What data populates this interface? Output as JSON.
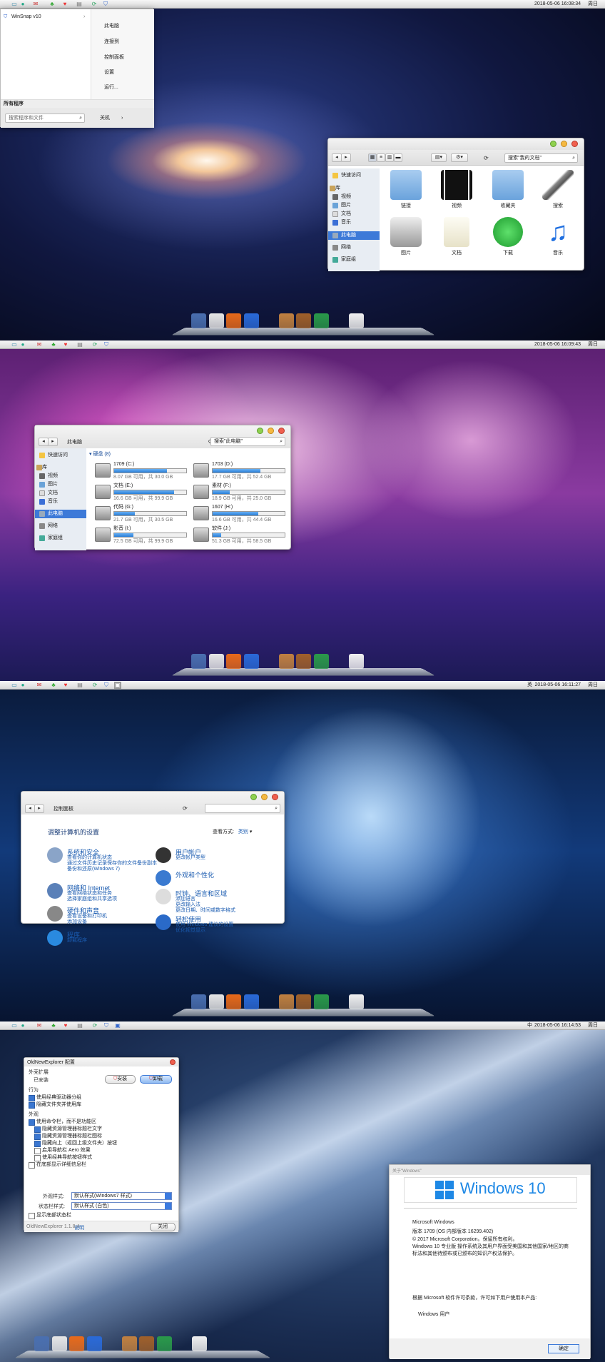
{
  "menubar": {
    "clocks": [
      "2018-05-06  16:08:34",
      "2018-05-06  16:09:43",
      "2018-05-06  16:11:27",
      "2018-05-06  16:14:53"
    ],
    "weekday": "周日",
    "langs": [
      "",
      "",
      "英",
      "中"
    ]
  },
  "start_menu": {
    "pinned": "WinSnap v10",
    "right_items": [
      "此电脑",
      "连接到",
      "控制面板",
      "设置",
      "运行..."
    ],
    "all_programs": "所有程序",
    "search_placeholder": "搜索程序和文件",
    "shutdown": "关机"
  },
  "explorer1": {
    "address": "",
    "search": "搜索\"我的文档\"",
    "sidebar": [
      "快速访问",
      "库",
      "视频",
      "图片",
      "文档",
      "音乐",
      "此电脑",
      "网络",
      "家庭组"
    ],
    "icons": [
      "链接",
      "视频",
      "收藏夹",
      "搜索",
      "图片",
      "文档",
      "下载",
      "音乐"
    ]
  },
  "explorer2": {
    "address": "此电脑",
    "search": "搜索\"此电脑\"",
    "group": "硬盘 (8)",
    "sidebar": [
      "快速访问",
      "库",
      "视频",
      "图片",
      "文档",
      "音乐",
      "此电脑",
      "网络",
      "家庭组"
    ],
    "drives": [
      {
        "name": "1709 (C:)",
        "free": "8.07 GB 可用，共 30.0 GB",
        "used": 0.73
      },
      {
        "name": "1703 (D:)",
        "free": "17.7 GB 可用，共 52.4 GB",
        "used": 0.66
      },
      {
        "name": "文档 (E:)",
        "free": "16.6 GB 可用，共 99.9 GB",
        "used": 0.83
      },
      {
        "name": "素材 (F:)",
        "free": "18.9 GB 可用，共 25.0 GB",
        "used": 0.24
      },
      {
        "name": "代码 (G:)",
        "free": "21.7 GB 可用，共 30.5 GB",
        "used": 0.29
      },
      {
        "name": "1607 (H:)",
        "free": "16.6 GB 可用，共 44.4 GB",
        "used": 0.63
      },
      {
        "name": "影音 (I:)",
        "free": "72.5 GB 可用，共 99.9 GB",
        "used": 0.27
      },
      {
        "name": "软件 (J:)",
        "free": "51.3 GB 可用，共 58.5 GB",
        "used": 0.12
      }
    ]
  },
  "control_panel": {
    "address": "控制面板",
    "heading": "调整计算机的设置",
    "view_by": "查看方式:",
    "view_value": "类别",
    "items": [
      {
        "title": "系统和安全",
        "lines": [
          "查看你的计算机状态",
          "通过文件历史记录保存你的文件备份副本",
          "备份和还原(Windows 7)"
        ]
      },
      {
        "title": "网络和 Internet",
        "lines": [
          "查看网络状态和任务",
          "选择家庭组和共享选项"
        ]
      },
      {
        "title": "硬件和声音",
        "lines": [
          "查看设备和打印机",
          "添加设备"
        ]
      },
      {
        "title": "程序",
        "lines": [
          "卸载程序"
        ]
      },
      {
        "title": "用户帐户",
        "lines": [
          "更改帐户类型"
        ]
      },
      {
        "title": "外观和个性化",
        "lines": []
      },
      {
        "title": "时钟、语言和区域",
        "lines": [
          "添加语言",
          "更改输入法",
          "更改日期、时间或数字格式"
        ]
      },
      {
        "title": "轻松使用",
        "lines": [
          "使用 Windows 建议的设置",
          "优化视觉显示"
        ]
      }
    ]
  },
  "one": {
    "title": "OldNewExplorer 配置",
    "ext_section": "外壳扩展",
    "installed": "已安装",
    "install_btn": "安装",
    "uninstall_btn": "卸载",
    "behavior": "行为",
    "behavior_opts": [
      "使用经典驱动器分组",
      "隐藏文件夹并使用库"
    ],
    "appearance": "外观",
    "appearance_opts": [
      {
        "t": "使用命令栏，而不是功能区",
        "on": true,
        "x": 0
      },
      {
        "t": "隐藏资源管理器标题栏文字",
        "on": true,
        "x": 1
      },
      {
        "t": "隐藏资源管理器标题栏图标",
        "on": true,
        "x": 1
      },
      {
        "t": "隐藏向上（返回上级文件夹）按钮",
        "on": true,
        "x": 1
      },
      {
        "t": "启用导航栏 Aero 效果",
        "on": false,
        "x": 1
      },
      {
        "t": "使用经典导航按钮样式",
        "on": false,
        "x": 1
      },
      {
        "t": "在底部显示详细信息栏",
        "on": false,
        "x": 0
      }
    ],
    "style_label": "外观样式:",
    "style_value": "默认样式(Windows7 样式)",
    "status_label": "状态栏样式:",
    "status_value": "默认样式 (白色)",
    "show_status": "显示底部状态栏",
    "version": "OldNewExplorer 1.1.8.4",
    "about_link": "说明",
    "close_btn": "关闭"
  },
  "winver": {
    "title": "关于\"Windows\"",
    "logo_text": "Windows 10",
    "lines": [
      "Microsoft Windows",
      "版本 1709 (OS 内部版本 16299.402)",
      "© 2017 Microsoft Corporation。保留所有权利。",
      "Windows 10 专业版 操作系统及其用户界面受美国和其他国家/地区的商标法和其他待颁布或已颁布的知识产权法保护。"
    ],
    "license": "根据 Microsoft 软件许可条款，许可如下用户使用本产品:",
    "user": "Windows 用户",
    "ok": "确定"
  },
  "icons": {
    "apple": "apple-icon",
    "finder": "finder-icon",
    "colors": {
      "accent": "#3d7ad8",
      "win10": "#1e88e5"
    }
  }
}
